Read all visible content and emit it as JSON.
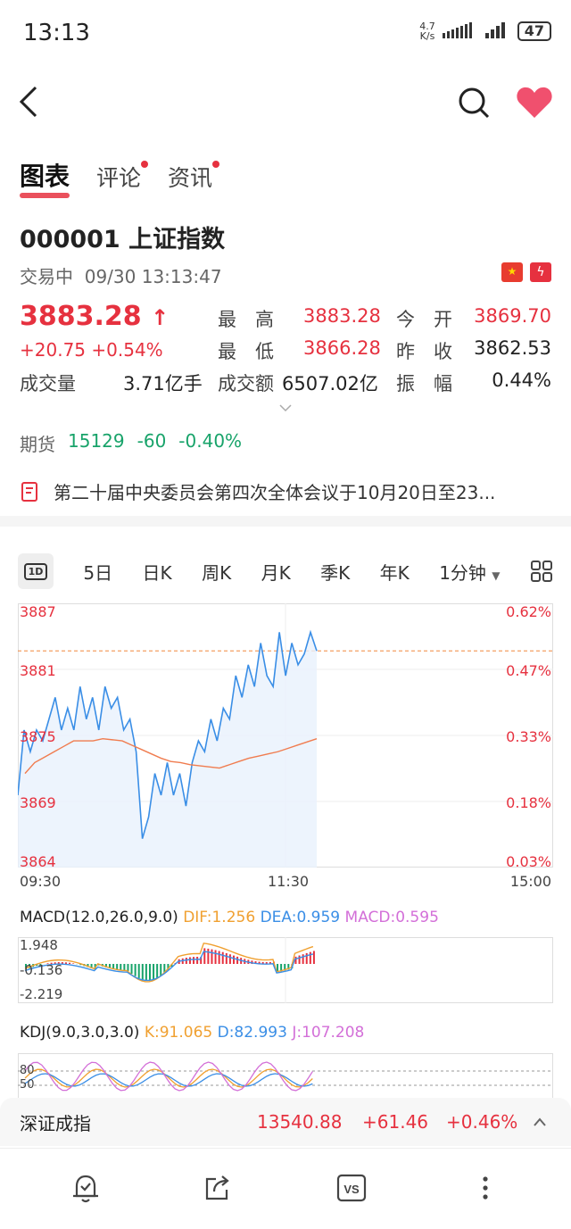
{
  "status_bar": {
    "time": "13:13",
    "speed_top": "4.7",
    "speed_bottom": "K/s",
    "battery": "47"
  },
  "tabs": [
    {
      "label": "图表",
      "active": true,
      "dot": false
    },
    {
      "label": "评论",
      "active": false,
      "dot": true
    },
    {
      "label": "资讯",
      "active": false,
      "dot": true
    }
  ],
  "stock": {
    "code_name": "000001 上证指数",
    "status": "交易中",
    "datetime": "09/30 13:13:47",
    "price": "3883.28",
    "arrow": "↑",
    "change": "+20.75",
    "change_pct": "+0.54%",
    "volume_label": "成交量",
    "volume": "3.71亿手",
    "high_label": "最　高",
    "high": "3883.28",
    "low_label": "最　低",
    "low": "3866.28",
    "amount_label": "成交额",
    "amount": "6507.02亿",
    "open_label": "今　开",
    "open": "3869.70",
    "prev_label": "昨　收",
    "prev": "3862.53",
    "amp_label": "振　幅",
    "amp": "0.44%"
  },
  "futures": {
    "label": "期货",
    "value": "15129",
    "change": "-60",
    "pct": "-0.40%"
  },
  "news": {
    "text": "第二十届中央委员会第四次全体会议于10月20日至23..."
  },
  "periods": [
    "1D",
    "5日",
    "日K",
    "周K",
    "月K",
    "季K",
    "年K",
    "1分钟"
  ],
  "chart": {
    "y_left": [
      "3887",
      "3881",
      "3875",
      "3869",
      "3864"
    ],
    "y_right": [
      "0.62%",
      "0.47%",
      "0.33%",
      "0.18%",
      "0.03%"
    ],
    "x_labels": [
      "09:30",
      "11:30",
      "15:00"
    ]
  },
  "chart_data": {
    "type": "line",
    "ylim": [
      3864,
      3887
    ],
    "prev_close_line": 3883.28,
    "series": [
      {
        "values": [
          3870,
          3876,
          3874,
          3876,
          3875,
          3877,
          3879,
          3876,
          3878,
          3876,
          3880,
          3877,
          3879,
          3876,
          3880,
          3878,
          3879,
          3876,
          3877,
          3874,
          3866,
          3868,
          3872,
          3870,
          3873,
          3870,
          3872,
          3869,
          3873,
          3875,
          3874,
          3877,
          3875,
          3878,
          3877,
          3881,
          3879,
          3882,
          3880,
          3884,
          3881,
          3880,
          3885,
          3881,
          3884,
          3882,
          3883,
          3885,
          3883.28
        ]
      },
      {
        "values": [
          3872,
          3873,
          3873.5,
          3874,
          3874.5,
          3875,
          3875,
          3875,
          3875.2,
          3875.1,
          3875,
          3874.6,
          3874.2,
          3873.8,
          3873.4,
          3873.1,
          3873,
          3872.8,
          3872.7,
          3872.6,
          3872.5,
          3872.8,
          3873.1,
          3873.4,
          3873.6,
          3873.8,
          3874,
          3874.3,
          3874.6,
          3874.9,
          3875.2
        ]
      }
    ]
  },
  "macd": {
    "label": "MACD(12.0,26.0,9.0)",
    "dif": "DIF:1.256",
    "dea": "DEA:0.959",
    "macd": "MACD:0.595",
    "ticks": [
      "1.948",
      "-0.136",
      "-2.219"
    ]
  },
  "kdj": {
    "label": "KDJ(9.0,3.0,3.0)",
    "k": "K:91.065",
    "d": "D:82.993",
    "j": "J:107.208",
    "ticks": [
      "80",
      "50"
    ]
  },
  "bottom_quote": {
    "name": "深证成指",
    "price": "13540.88",
    "change": "+61.46",
    "pct": "+0.46%"
  },
  "colors": {
    "up": "#e6313f",
    "down": "#18a36a",
    "line": "#3a8ee6",
    "avg": "#f07c4f"
  }
}
